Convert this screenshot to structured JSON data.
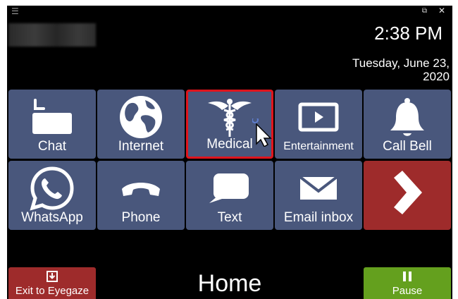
{
  "window": {
    "menu_glyph": "☰",
    "restore_glyph": "⧉",
    "close_glyph": "✕"
  },
  "header": {
    "time": "2:38 PM",
    "date": "Tuesday, June 23, 2020"
  },
  "tiles": [
    {
      "label": "Chat",
      "icon": "keyboard-icon"
    },
    {
      "label": "Internet",
      "icon": "globe-icon"
    },
    {
      "label": "Medical",
      "icon": "caduceus-icon",
      "selected": true
    },
    {
      "label": "Entertainment",
      "icon": "play-screen-icon"
    },
    {
      "label": "Call Bell",
      "icon": "bell-icon"
    },
    {
      "label": "WhatsApp",
      "icon": "whatsapp-icon"
    },
    {
      "label": "Phone",
      "icon": "phone-handset-icon"
    },
    {
      "label": "Text",
      "icon": "speech-bubble-icon"
    },
    {
      "label": "Email inbox",
      "icon": "envelope-icon"
    },
    {
      "label": "",
      "icon": "chevron-right-icon"
    }
  ],
  "footer": {
    "exit_label": "Exit to Eyegaze",
    "page_title": "Home",
    "pause_label": "Pause"
  },
  "colors": {
    "tile": "#49577c",
    "selected_border": "#e0141c",
    "next_tile": "#9e2b2b",
    "exit": "#9e2b2b",
    "pause": "#64a01e",
    "background": "#000000"
  }
}
